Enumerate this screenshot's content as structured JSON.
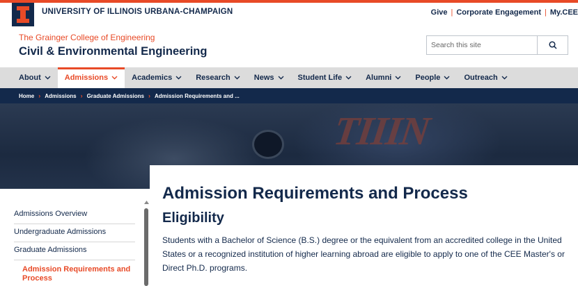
{
  "header": {
    "university_name": "UNIVERSITY OF ILLINOIS URBANA-CHAMPAIGN",
    "utility_links": [
      "Give",
      "Corporate Engagement",
      "My.CEE"
    ],
    "college": "The Grainger College of Engineering",
    "department": "Civil & Environmental Engineering"
  },
  "search": {
    "placeholder": "Search this site"
  },
  "nav": {
    "items": [
      {
        "label": "About"
      },
      {
        "label": "Admissions"
      },
      {
        "label": "Academics"
      },
      {
        "label": "Research"
      },
      {
        "label": "News"
      },
      {
        "label": "Student Life"
      },
      {
        "label": "Alumni"
      },
      {
        "label": "People"
      },
      {
        "label": "Outreach"
      }
    ]
  },
  "breadcrumb": [
    "Home",
    "Admissions",
    "Graduate Admissions",
    "Admission Requirements and ..."
  ],
  "hero": {
    "shirt_text": "TIIIN"
  },
  "main": {
    "title": "Admission Requirements and Process",
    "section_title": "Eligibility",
    "paragraph": "Students with a Bachelor of Science (B.S.) degree or the equivalent from an accredited college in the United States or a recognized institution of higher learning abroad are eligible to apply to one of the CEE Master's or Direct Ph.D. programs."
  },
  "sidebar": {
    "items": [
      {
        "label": "Admissions Overview"
      },
      {
        "label": "Undergraduate Admissions"
      },
      {
        "label": "Graduate Admissions"
      },
      {
        "label": "Admission Requirements and Process"
      }
    ]
  },
  "colors": {
    "navy": "#13294b",
    "orange": "#e84a27",
    "nav_bg": "#dcdcdc"
  }
}
